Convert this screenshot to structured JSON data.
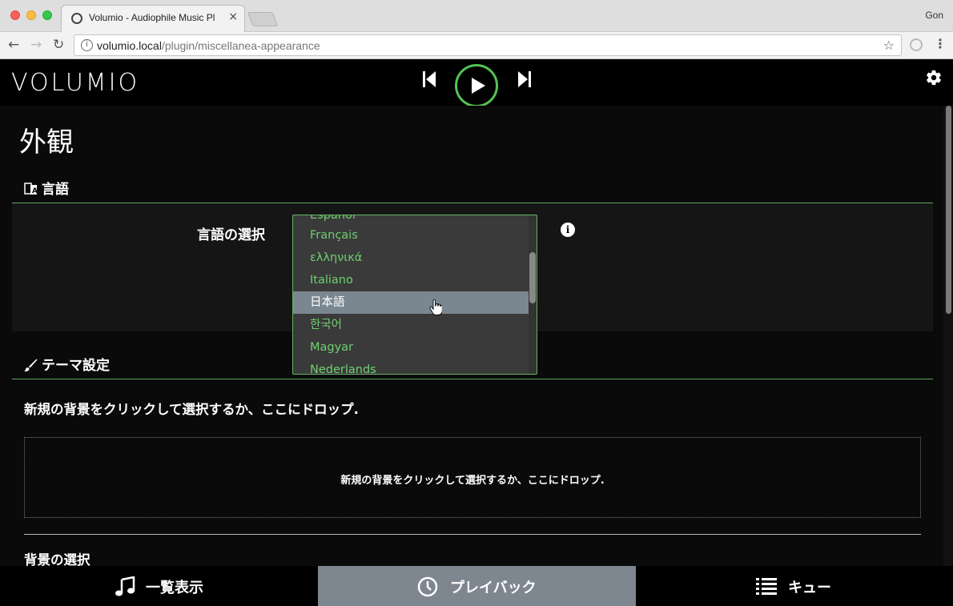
{
  "browser": {
    "tab_title": "Volumio - Audiophile Music Pl",
    "tab_close": "×",
    "profile": "Gon",
    "url_host": "volumio.local",
    "url_path": "/plugin/miscellanea-appearance",
    "back": "←",
    "forward": "→",
    "reload": "↻",
    "star": "☆",
    "menu": "⋮",
    "info_glyph": "i"
  },
  "header": {
    "logo": "VOLUMIO"
  },
  "page": {
    "title": "外観",
    "language_section": "言語",
    "language_label": "言語の選択",
    "info_glyph": "i",
    "theme_section": "テーマ設定",
    "drop_title": "新規の背景をクリックして選択するか、ここにドロップ.",
    "drop_text": "新規の背景をクリックして選択するか、ここにドロップ.",
    "bg_select": "背景の選択"
  },
  "languages": {
    "items": [
      "Español",
      "Français",
      "ελληνικά",
      "Italiano",
      "日本語",
      "한국어",
      "Magyar",
      "Nederlands"
    ],
    "selected": "日本語"
  },
  "bottom_nav": {
    "browse": "一覧表示",
    "playback": "プレイバック",
    "queue": "キュー"
  },
  "colors": {
    "accent": "#54c254",
    "selected_bg": "#7b8790",
    "active_tab": "#7e8790"
  },
  "icons": {
    "language": "language-icon",
    "theme": "brush-icon",
    "browse": "music-note-icon",
    "playback": "clock-icon",
    "queue": "list-icon"
  }
}
